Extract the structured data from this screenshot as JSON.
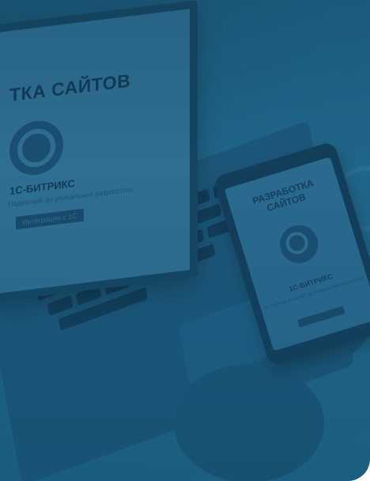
{
  "laptop": {
    "title": "ТКА САЙТОВ",
    "brand": "1С-БИТРИКС",
    "subtitle": "Надежный до уникальной разработки",
    "button": "Интеграция с 1С"
  },
  "phone": {
    "title_line1": "РАЗРАБОТКА",
    "title_line2": "САЙТОВ",
    "brand": "1С-БИТРИКС",
    "subtitle": "от готовых решений до уникальной разработки"
  },
  "colors": {
    "overlay": "#1f6588",
    "dark": "#123a55"
  }
}
